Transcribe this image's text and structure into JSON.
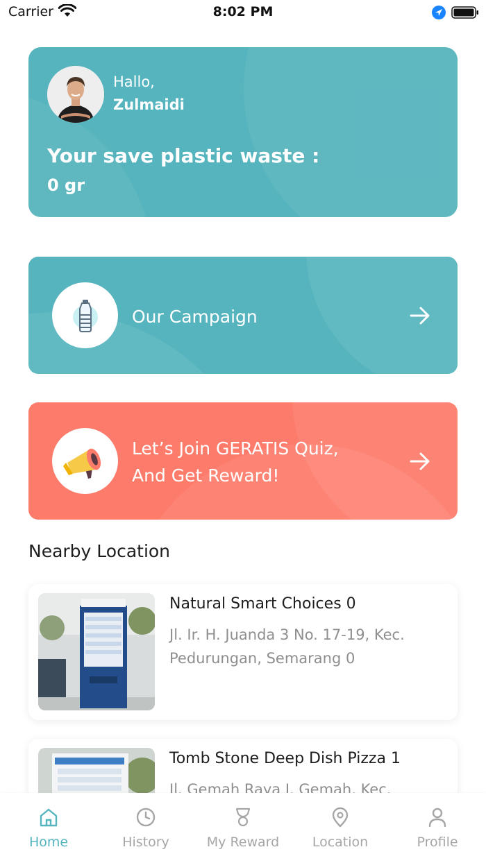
{
  "status_bar": {
    "carrier": "Carrier",
    "time": "8:02 PM"
  },
  "header": {
    "greeting": "Hallo,",
    "username": "Zulmaidi",
    "save_label": "Your save plastic waste :",
    "save_value": "0 gr"
  },
  "campaign_card": {
    "title": "Our Campaign",
    "icon": "water-bottle-icon"
  },
  "quiz_card": {
    "line1": "Let’s Join GERATIS Quiz,",
    "line2": "And Get Reward!",
    "icon": "megaphone-icon"
  },
  "nearby": {
    "title": "Nearby Location",
    "items": [
      {
        "name": "Natural Smart Choices 0",
        "address": "Jl. Ir. H. Juanda 3 No. 17-19, Kec. Pedurungan, Semarang 0"
      },
      {
        "name": "Tomb Stone Deep Dish Pizza 1",
        "address": "Jl. Gemah Raya I, Gemah, Kec."
      }
    ]
  },
  "nav": {
    "items": [
      {
        "label": "Home",
        "icon": "home-icon",
        "active": true
      },
      {
        "label": "History",
        "icon": "clock-icon",
        "active": false
      },
      {
        "label": "My Reward",
        "icon": "trophy-icon",
        "active": false
      },
      {
        "label": "Location",
        "icon": "map-pin-icon",
        "active": false
      },
      {
        "label": "Profile",
        "icon": "user-icon",
        "active": false
      }
    ]
  },
  "colors": {
    "teal": "#55b4bd",
    "coral": "#fd7b6b",
    "inactive": "#a6a6a6"
  }
}
